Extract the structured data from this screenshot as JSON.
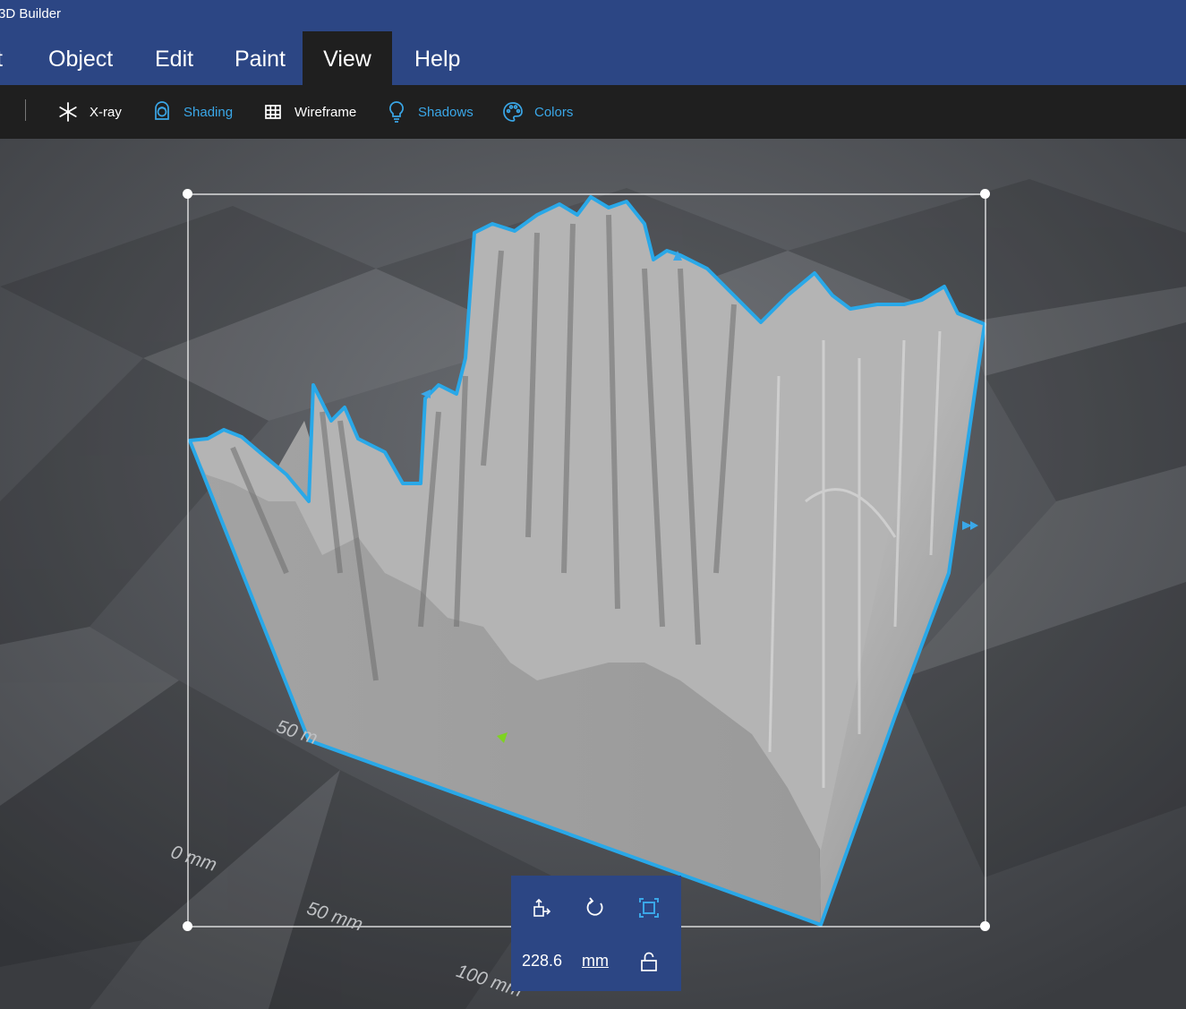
{
  "app": {
    "title": "3D Builder"
  },
  "menu": {
    "items": [
      {
        "label": "t"
      },
      {
        "label": "Object"
      },
      {
        "label": "Edit"
      },
      {
        "label": "Paint"
      },
      {
        "label": "View",
        "active": true
      },
      {
        "label": "Help"
      }
    ]
  },
  "toolbar": {
    "xray": {
      "label": "X-ray",
      "icon": "asterisk-icon"
    },
    "shading": {
      "label": "Shading",
      "icon": "shading-icon"
    },
    "wireframe": {
      "label": "Wireframe",
      "icon": "wireframe-icon"
    },
    "shadows": {
      "label": "Shadows",
      "icon": "lightbulb-icon"
    },
    "colors": {
      "label": "Colors",
      "icon": "palette-icon"
    }
  },
  "rulers": {
    "left_50": "50 m",
    "zero": "0 mm",
    "bottom_50": "50 mm",
    "bottom_100": "100 mm"
  },
  "size_panel": {
    "value": "228.6",
    "unit": "mm",
    "buttons": [
      "move-icon",
      "rotate-icon",
      "scale-icon",
      "lock-icon"
    ]
  },
  "colors": {
    "header": "#2c4684",
    "toolbar": "#1f1f1f",
    "accent": "#3aa7e8",
    "selection_outline": "#29a8e8",
    "model": "#9a9a9a"
  }
}
